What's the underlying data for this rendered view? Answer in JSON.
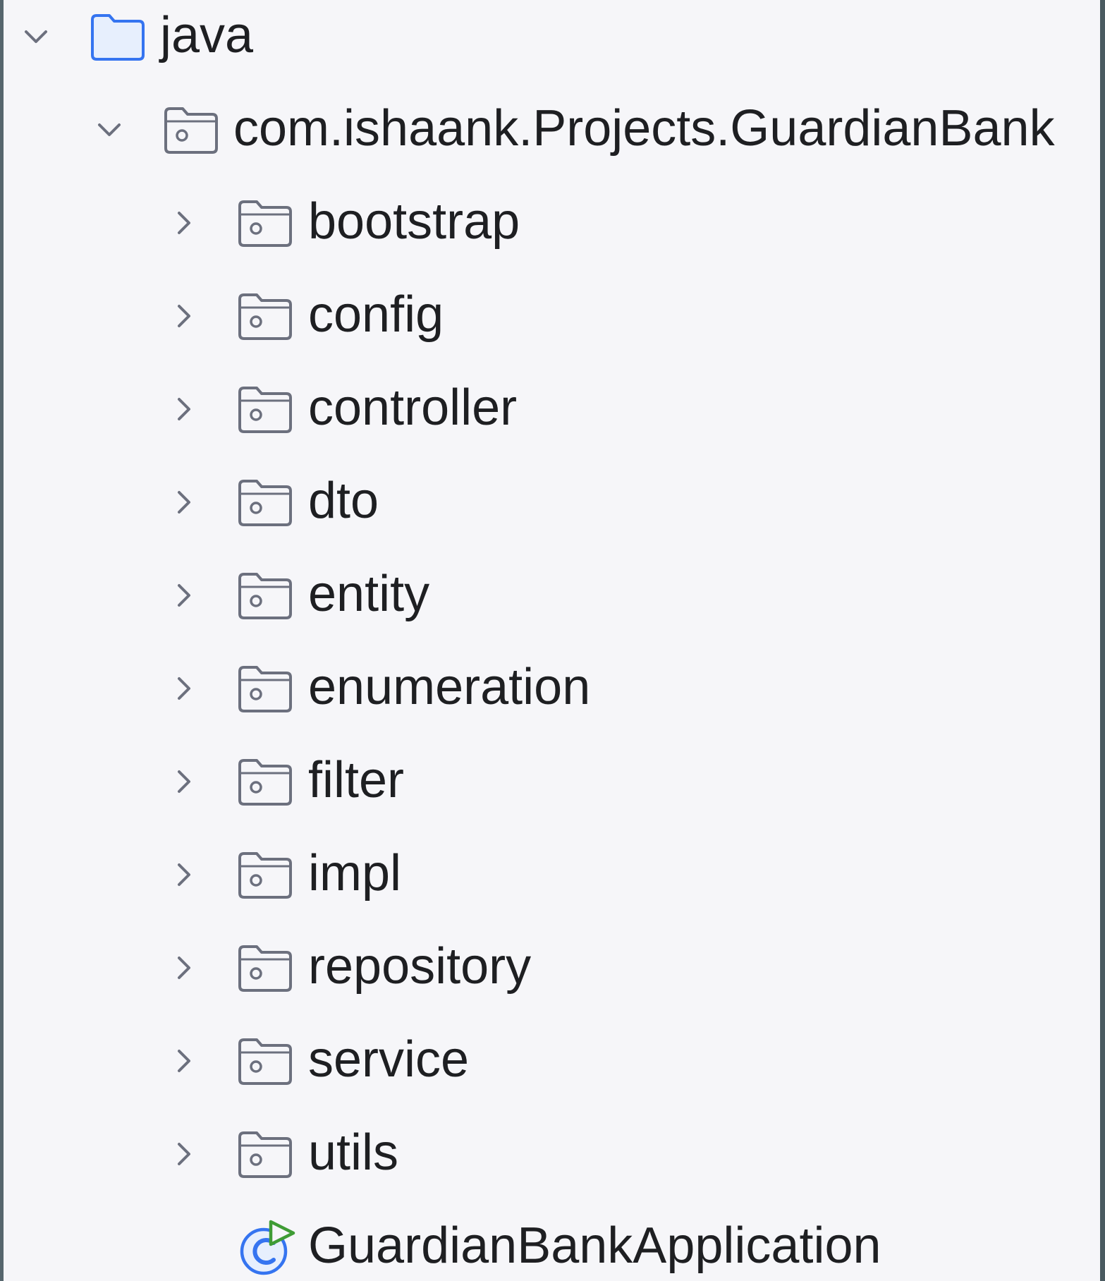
{
  "tree": {
    "root": {
      "label": "java",
      "icon": "source-folder-icon",
      "expanded": true
    },
    "package": {
      "label": "com.ishaank.Projects.GuardianBank",
      "icon": "package-icon",
      "expanded": true
    },
    "children": [
      {
        "label": "bootstrap",
        "icon": "package-icon",
        "expanded": false
      },
      {
        "label": "config",
        "icon": "package-icon",
        "expanded": false
      },
      {
        "label": "controller",
        "icon": "package-icon",
        "expanded": false
      },
      {
        "label": "dto",
        "icon": "package-icon",
        "expanded": false
      },
      {
        "label": "entity",
        "icon": "package-icon",
        "expanded": false
      },
      {
        "label": "enumeration",
        "icon": "package-icon",
        "expanded": false
      },
      {
        "label": "filter",
        "icon": "package-icon",
        "expanded": false
      },
      {
        "label": "impl",
        "icon": "package-icon",
        "expanded": false
      },
      {
        "label": "repository",
        "icon": "package-icon",
        "expanded": false
      },
      {
        "label": "service",
        "icon": "package-icon",
        "expanded": false
      },
      {
        "label": "utils",
        "icon": "package-icon",
        "expanded": false
      }
    ],
    "application": {
      "label": "GuardianBankApplication",
      "icon": "spring-boot-application-icon"
    }
  },
  "colors": {
    "background": "#f6f6f9",
    "text": "#1e1f22",
    "icon_gray": "#6c707e",
    "source_folder_blue": "#3574f0",
    "source_folder_fill": "#e7effd",
    "run_green": "#3f9c35"
  }
}
